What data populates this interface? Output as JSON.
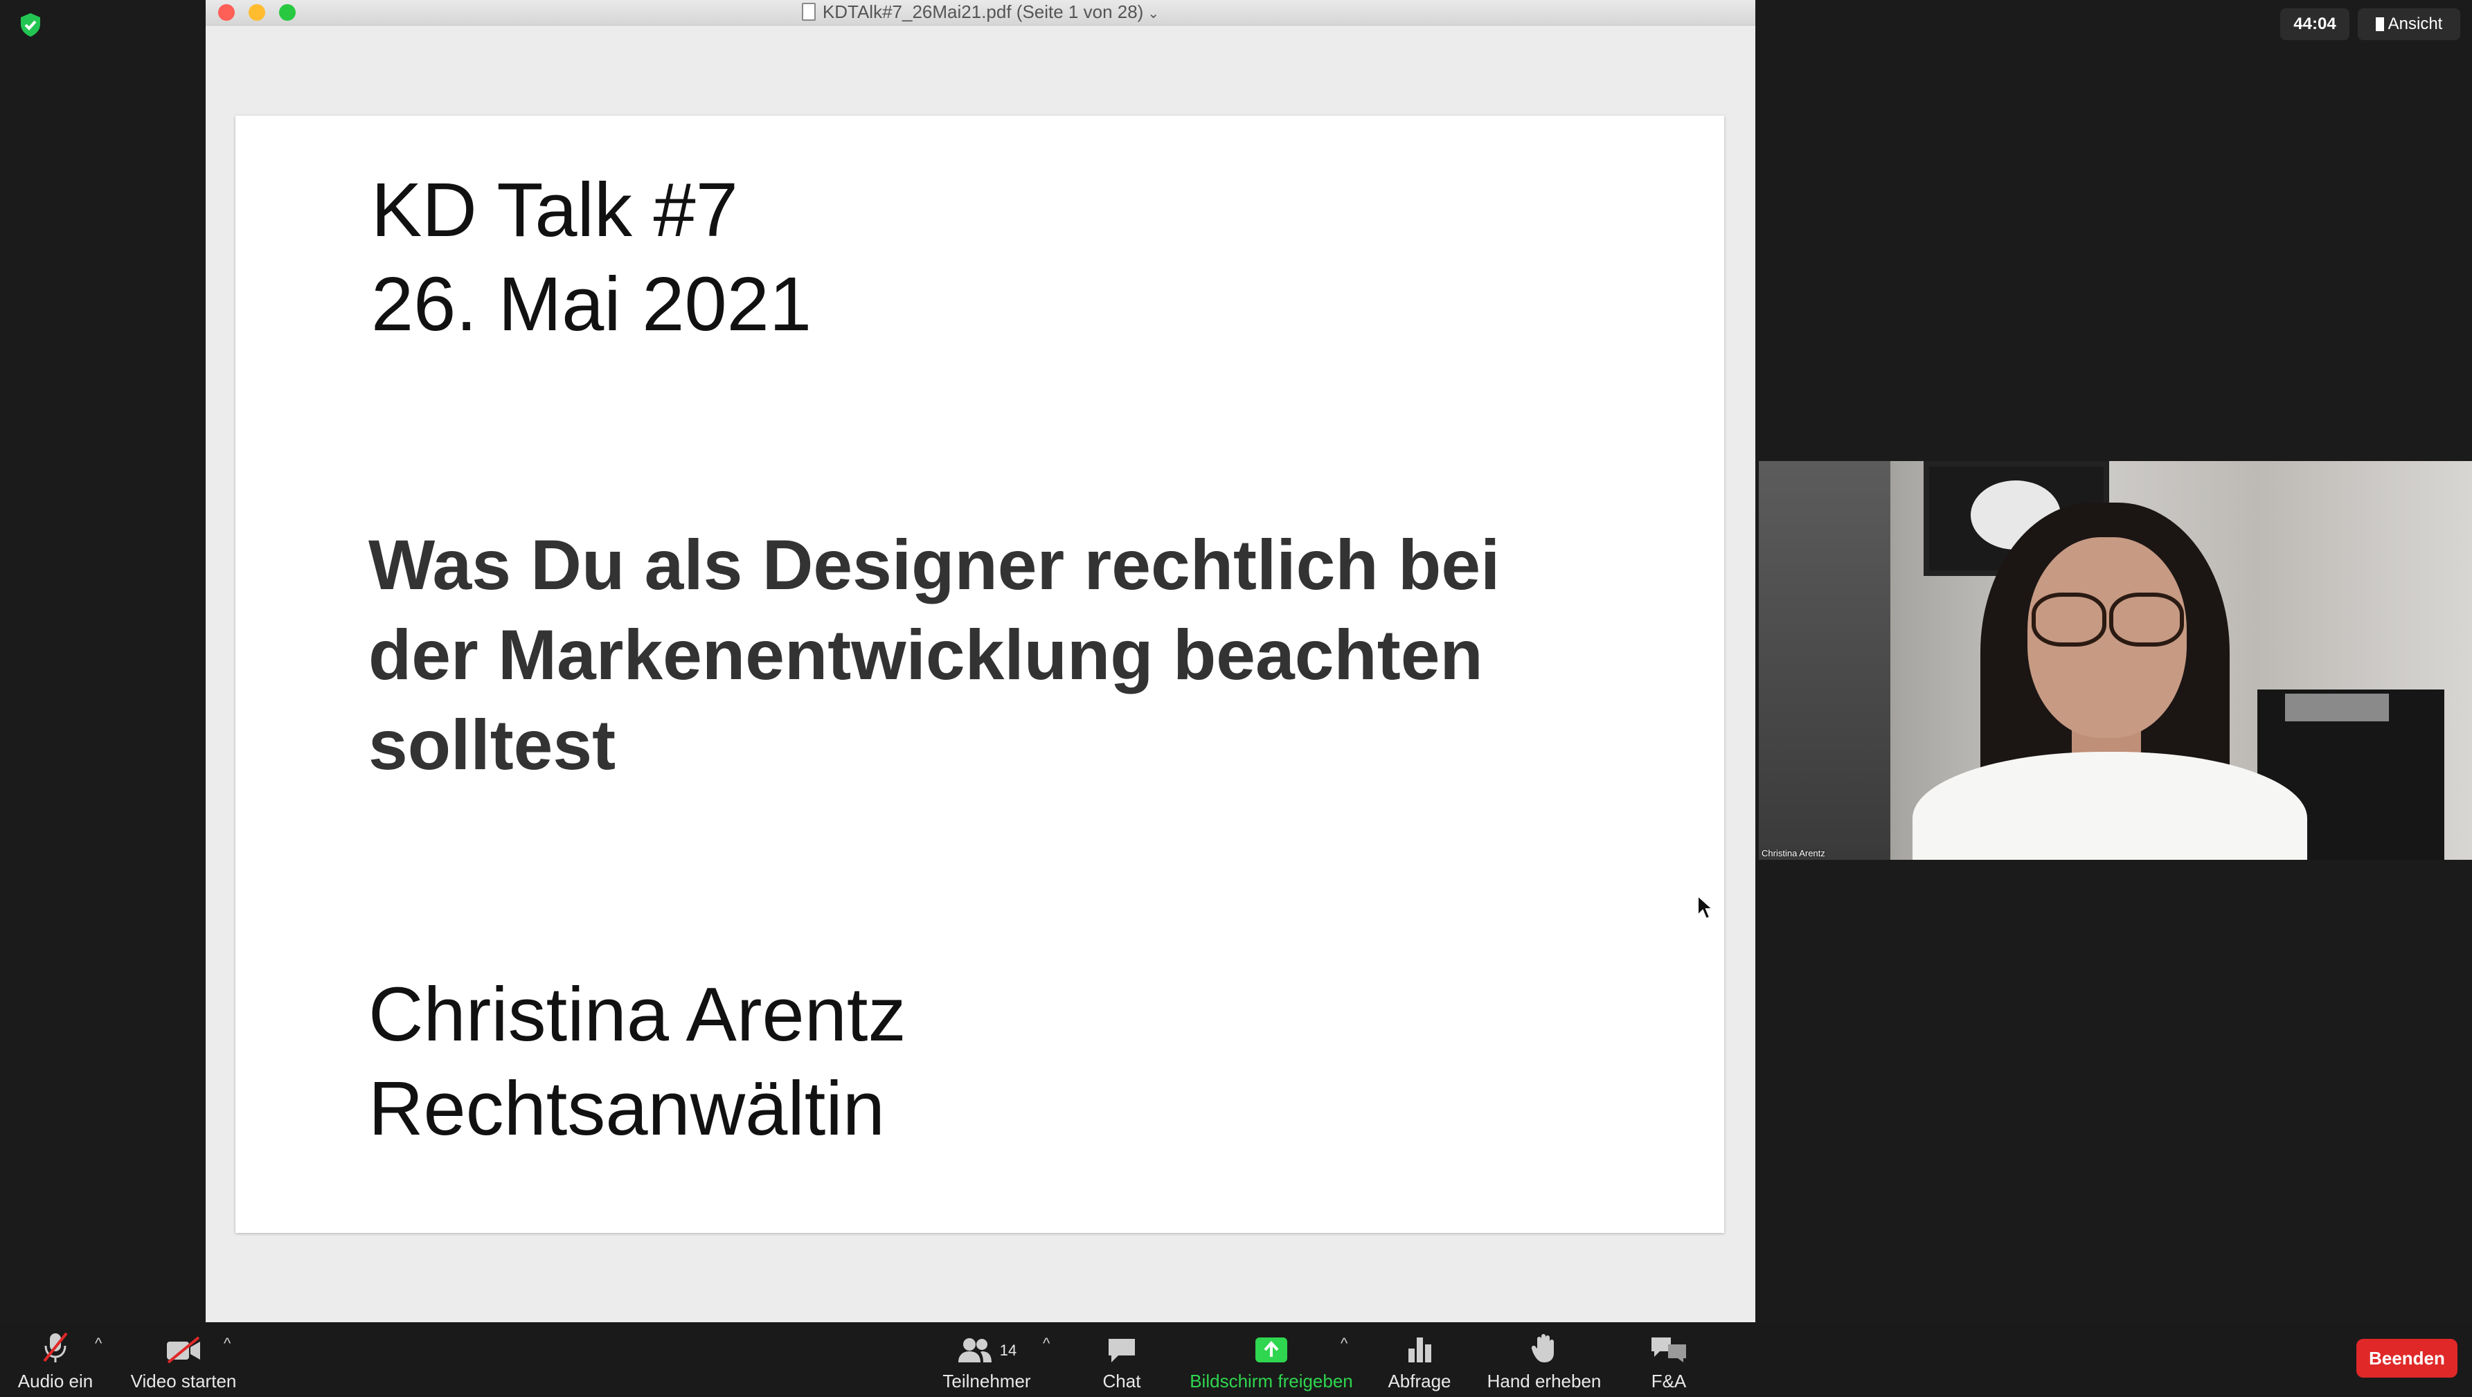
{
  "document_window": {
    "title": "KDTAlk#7_26Mai21.pdf (Seite 1 von 28)"
  },
  "slide": {
    "line1": "KD Talk #7",
    "line2": "26. Mai 2021",
    "headline": [
      "Was Du als Designer rechtlich bei",
      "der Markenentwicklung beachten",
      "solltest"
    ],
    "speaker_name": "Christina Arentz",
    "speaker_role": "Rechtsanwältin"
  },
  "meeting": {
    "timer": "44:04",
    "view_label": "Ansicht",
    "participant_name": "Christina Arentz"
  },
  "toolbar": {
    "audio_label": "Audio ein",
    "video_label": "Video starten",
    "participants_label": "Teilnehmer",
    "participants_count": "14",
    "chat_label": "Chat",
    "share_label": "Bildschirm freigeben",
    "poll_label": "Abfrage",
    "raise_hand_label": "Hand erheben",
    "qa_label": "F&A",
    "end_label": "Beenden"
  },
  "colors": {
    "share_accent": "#2fd64f",
    "end_button": "#e02828",
    "toolbar_bg": "#1a1a1a"
  },
  "icons": {
    "security": "shield-check-icon",
    "audio": "microphone-muted-icon",
    "video": "camera-off-icon",
    "participants": "people-icon",
    "chat": "chat-bubble-icon",
    "share": "share-screen-icon",
    "poll": "bar-chart-icon",
    "raise_hand": "hand-icon",
    "qa": "qa-bubbles-icon"
  }
}
